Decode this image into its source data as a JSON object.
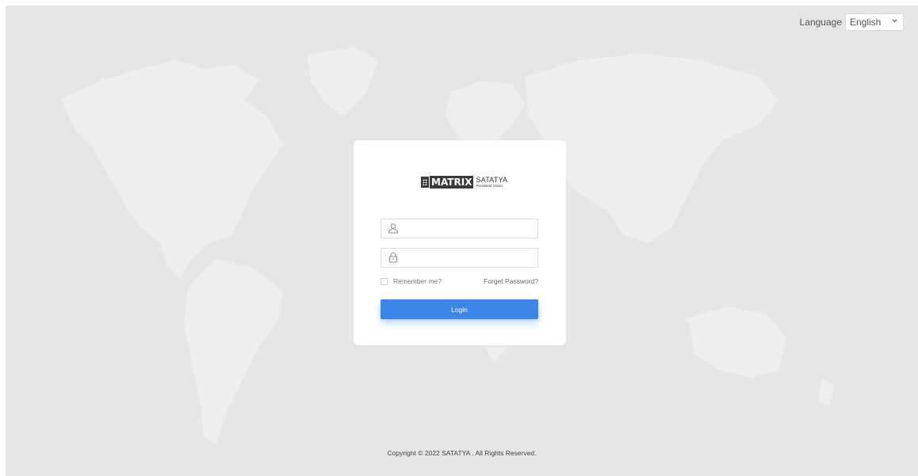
{
  "header": {
    "language_label": "Language",
    "language_selected": "English"
  },
  "brand": {
    "mark": "MATRIX",
    "name": "SATATYA",
    "tagline": "Persistent Vision"
  },
  "login": {
    "username_value": "",
    "password_value": "",
    "remember_label": "Remember me?",
    "forget_label": "Forget Password?",
    "submit_label": "Login"
  },
  "footer": {
    "copyright": "Copyright © 2022 SATATYA . All Rights Reserved."
  },
  "colors": {
    "background": "#e6e6e6",
    "map_land": "#eeeeee",
    "primary_button": "#3d85e6"
  },
  "icons": {
    "username": "user-icon",
    "password": "lock-icon",
    "language_dropdown": "chevron-down-icon"
  }
}
